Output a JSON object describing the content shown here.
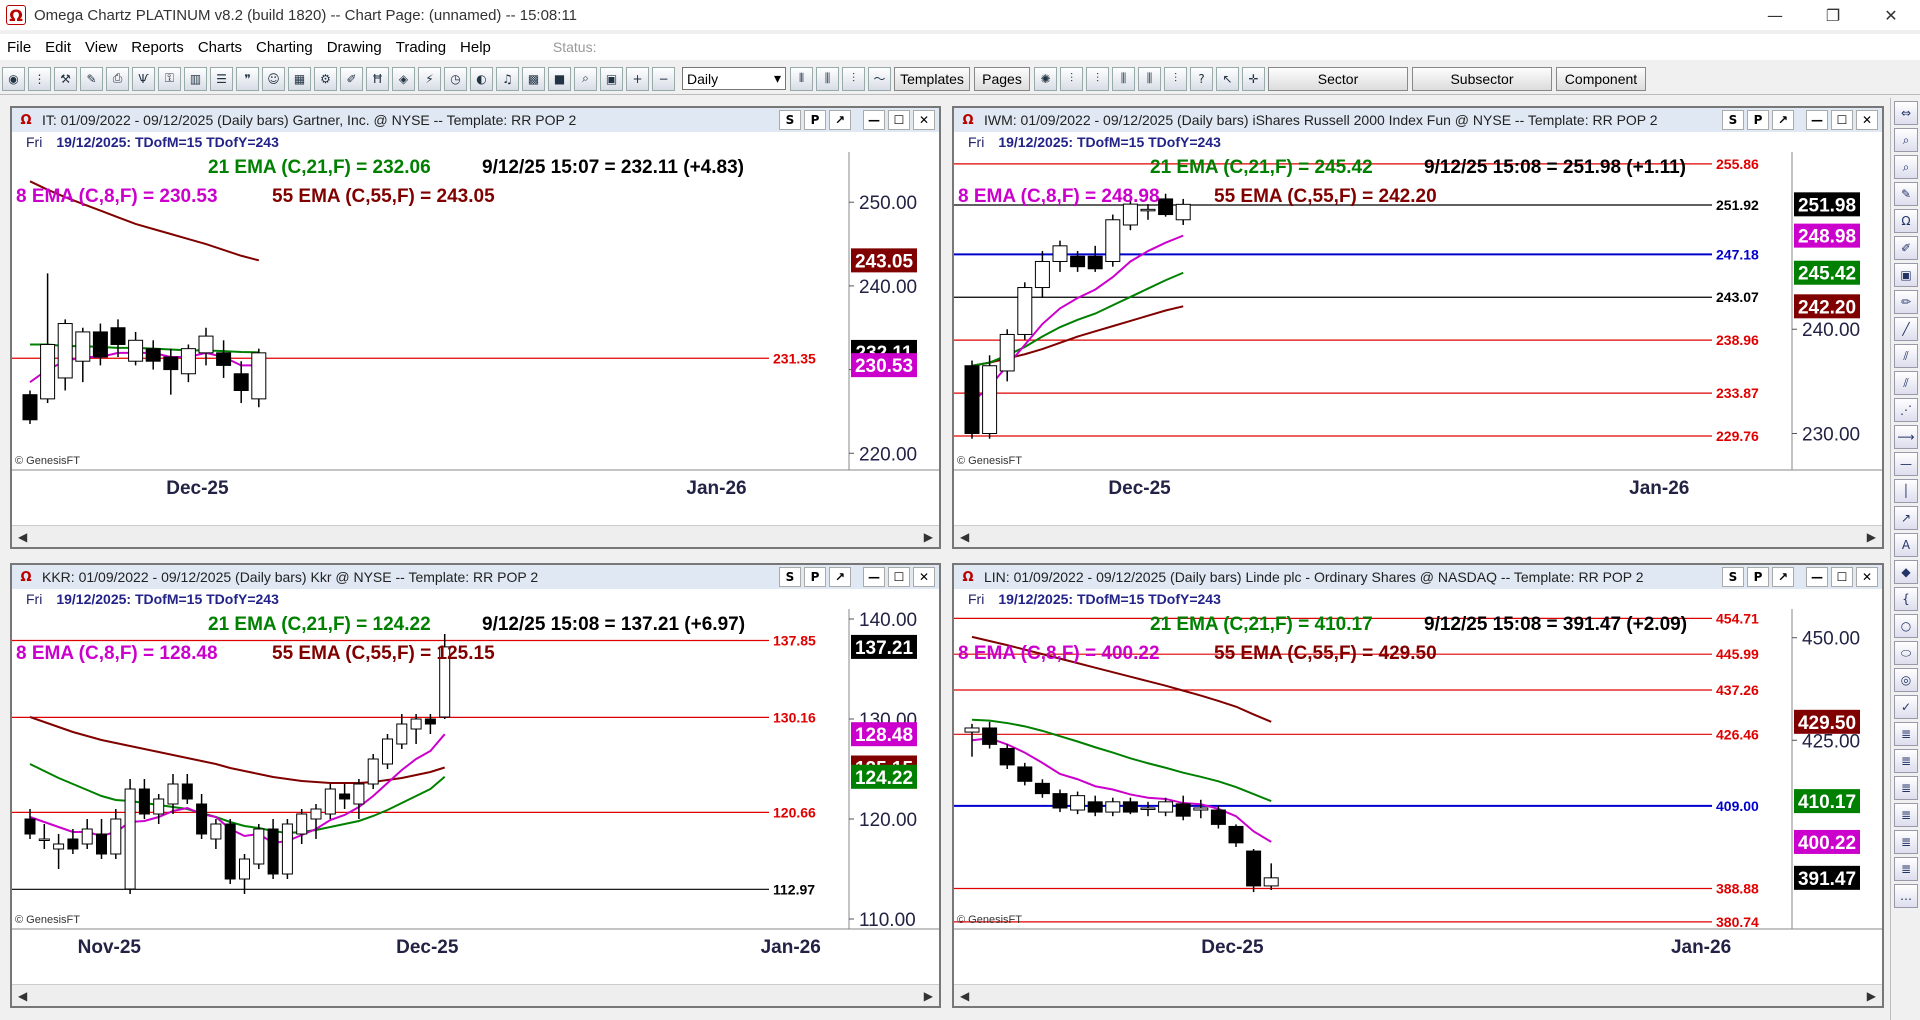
{
  "window": {
    "title": "Omega Chartz PLATINUM v8.2 (build 1820)  --  Chart Page: (unnamed) -- 15:08:11",
    "logo_glyph": "Ω",
    "controls": [
      "—",
      "❐",
      "✕"
    ]
  },
  "menu": {
    "items": [
      "File",
      "Edit",
      "View",
      "Reports",
      "Charts",
      "Charting",
      "Drawing",
      "Trading",
      "Help"
    ],
    "status_label": "Status:"
  },
  "toolbar": {
    "period_select": "Daily",
    "buttons": {
      "templates": "Templates",
      "pages": "Pages",
      "sector": "Sector",
      "subsector": "Subsector",
      "component": "Component"
    }
  },
  "colors": {
    "ema21": "#008000",
    "ema8": "#cc00cc",
    "ema55": "#800000",
    "hline_red": "#e00000",
    "hline_blue": "#0000cc",
    "header_bg": "#dfe8f3"
  },
  "panels": [
    {
      "key": "it",
      "header": "IT: 01/09/2022 - 09/12/2025  (Daily bars)   Gartner, Inc. @ NYSE  --  Template: RR POP 2",
      "sub": {
        "day": "Fri",
        "info": "19/12/2025:   TDofM=15   TDofY=243"
      },
      "ema21_text": "21 EMA (C,21,F) = 232.06",
      "quote_text": "9/12/25 15:07 = 232.11 (+4.83)",
      "ema8_text": "8 EMA (C,8,F) = 230.53",
      "ema55_text": "55 EMA (C,55,F) = 243.05",
      "copyright": "© GenesisFT",
      "x_labels": [
        {
          "text": "Dec-25",
          "pos": 0.2
        },
        {
          "text": "Jan-26",
          "pos": 0.76
        }
      ],
      "y_ticks": [
        220,
        230,
        240,
        250
      ],
      "y_tick_labels": [
        "220.00",
        "",
        "240.00",
        "250.00"
      ],
      "ylim": [
        218,
        256
      ],
      "hlines": [
        {
          "value": 231.35,
          "color": "red",
          "label": "231.35"
        }
      ],
      "badges": [
        {
          "value": 243.05,
          "text": "243.05",
          "bg": "#800000"
        },
        {
          "value": 232.11,
          "text": "232.11",
          "bg": "#000000"
        },
        {
          "value": 230.53,
          "text": "230.53",
          "bg": "#cc00cc"
        }
      ],
      "bars": [
        [
          227.0,
          227.5,
          223.5,
          224.0
        ],
        [
          226.5,
          241.5,
          226.0,
          233.0
        ],
        [
          229.0,
          236.0,
          227.5,
          235.5
        ],
        [
          231.0,
          235.0,
          228.5,
          234.5
        ],
        [
          234.5,
          235.5,
          230.5,
          231.5
        ],
        [
          235.0,
          236.0,
          231.5,
          233.0
        ],
        [
          231.0,
          234.5,
          230.5,
          233.5
        ],
        [
          232.5,
          233.5,
          230.0,
          231.0
        ],
        [
          231.5,
          232.5,
          227.0,
          230.0
        ],
        [
          229.5,
          233.0,
          228.5,
          232.5
        ],
        [
          232.0,
          235.0,
          230.5,
          234.0
        ],
        [
          232.0,
          233.5,
          229.0,
          230.5
        ],
        [
          229.5,
          231.0,
          226.0,
          227.5
        ],
        [
          226.5,
          232.5,
          225.5,
          232.0
        ]
      ],
      "ema8": [
        228.5,
        230.0,
        231.0,
        231.5,
        231.5,
        232.0,
        232.0,
        232.0,
        231.5,
        231.5,
        232.0,
        231.5,
        230.5,
        230.5
      ],
      "ema21": [
        233.0,
        233.0,
        232.8,
        232.8,
        232.7,
        232.6,
        232.6,
        232.5,
        232.4,
        232.3,
        232.3,
        232.2,
        232.1,
        232.06
      ],
      "ema55": [
        252.5,
        251.5,
        250.6,
        249.8,
        249.0,
        248.2,
        247.4,
        246.8,
        246.2,
        245.6,
        245.0,
        244.3,
        243.6,
        243.05
      ]
    },
    {
      "key": "iwm",
      "header": "IWM: 01/09/2022 - 09/12/2025  (Daily bars)   iShares Russell 2000 Index Fun @ NYSE  --  Template: RR POP 2",
      "sub": {
        "day": "Fri",
        "info": "19/12/2025:   TDofM=15   TDofY=243"
      },
      "ema21_text": "21 EMA (C,21,F) = 245.42",
      "quote_text": "9/12/25 15:08 = 251.98 (+1.11)",
      "ema8_text": "8 EMA (C,8,F) = 248.98",
      "ema55_text": "55 EMA (C,55,F) = 242.20",
      "copyright": "© GenesisFT",
      "x_labels": [
        {
          "text": "Dec-25",
          "pos": 0.2
        },
        {
          "text": "Jan-26",
          "pos": 0.76
        }
      ],
      "y_ticks": [
        230,
        240
      ],
      "y_tick_labels": [
        "230.00",
        "240.00"
      ],
      "ylim": [
        226.5,
        257
      ],
      "hlines": [
        {
          "value": 255.86,
          "color": "red",
          "label": "255.86"
        },
        {
          "value": 251.92,
          "color": "black",
          "label": "251.92"
        },
        {
          "value": 247.18,
          "color": "blue",
          "label": "247.18"
        },
        {
          "value": 243.07,
          "color": "black",
          "label": "243.07"
        },
        {
          "value": 238.96,
          "color": "red",
          "label": "238.96"
        },
        {
          "value": 233.87,
          "color": "red",
          "label": "233.87"
        },
        {
          "value": 229.76,
          "color": "red",
          "label": "229.76"
        }
      ],
      "badges": [
        {
          "value": 251.98,
          "text": "251.98",
          "bg": "#000000"
        },
        {
          "value": 248.98,
          "text": "248.98",
          "bg": "#cc00cc"
        },
        {
          "value": 245.42,
          "text": "245.42",
          "bg": "#008000"
        },
        {
          "value": 242.2,
          "text": "242.20",
          "bg": "#800000"
        }
      ],
      "bars": [
        [
          236.5,
          237.0,
          229.5,
          230.0
        ],
        [
          230.0,
          237.5,
          229.5,
          236.5
        ],
        [
          236.0,
          240.0,
          235.0,
          239.5
        ],
        [
          239.5,
          244.5,
          239.0,
          244.0
        ],
        [
          244.0,
          247.5,
          243.0,
          246.5
        ],
        [
          246.5,
          248.5,
          245.5,
          248.0
        ],
        [
          247.0,
          247.5,
          245.5,
          246.0
        ],
        [
          247.0,
          248.0,
          245.5,
          245.8
        ],
        [
          246.5,
          251.0,
          246.0,
          250.5
        ],
        [
          250.0,
          252.5,
          249.5,
          252.0
        ],
        [
          251.5,
          252.0,
          250.5,
          251.5
        ],
        [
          252.5,
          253.0,
          250.8,
          251.0
        ],
        [
          250.5,
          252.5,
          250.0,
          251.98
        ]
      ],
      "ema8": [
        233.0,
        234.5,
        236.5,
        238.5,
        240.5,
        242.0,
        243.0,
        243.8,
        245.0,
        246.5,
        247.5,
        248.3,
        248.98
      ],
      "ema21": [
        236.5,
        236.8,
        237.5,
        238.3,
        239.3,
        240.2,
        240.9,
        241.5,
        242.3,
        243.1,
        243.9,
        244.7,
        245.42
      ],
      "ema55": [
        236.5,
        236.8,
        237.2,
        237.6,
        238.1,
        238.7,
        239.3,
        239.8,
        240.3,
        240.8,
        241.3,
        241.8,
        242.2
      ]
    },
    {
      "key": "kkr",
      "header": "KKR: 01/09/2022 - 09/12/2025  (Daily bars)   Kkr @ NYSE  --  Template: RR POP 2",
      "sub": {
        "day": "Fri",
        "info": "19/12/2025:   TDofM=15   TDofY=243"
      },
      "ema21_text": "21 EMA (C,21,F) = 124.22",
      "quote_text": "9/12/25 15:08 = 137.21 (+6.97)",
      "ema8_text": "8 EMA (C,8,F) = 128.48",
      "ema55_text": "55 EMA (C,55,F) = 125.15",
      "copyright": "© GenesisFT",
      "x_labels": [
        {
          "text": "Nov-25",
          "pos": 0.105
        },
        {
          "text": "Dec-25",
          "pos": 0.448
        },
        {
          "text": "Jan-26",
          "pos": 0.84
        }
      ],
      "y_ticks": [
        110,
        120,
        130,
        140
      ],
      "y_tick_labels": [
        "110.00",
        "120.00",
        "130.00",
        "140.00"
      ],
      "ylim": [
        109,
        141
      ],
      "hlines": [
        {
          "value": 137.85,
          "color": "red",
          "label": "137.85"
        },
        {
          "value": 130.16,
          "color": "red",
          "label": "130.16"
        },
        {
          "value": 120.66,
          "color": "red",
          "label": "120.66"
        },
        {
          "value": 112.97,
          "color": "black",
          "label": "112.97"
        }
      ],
      "badges": [
        {
          "value": 137.21,
          "text": "137.21",
          "bg": "#000000"
        },
        {
          "value": 128.48,
          "text": "128.48",
          "bg": "#cc00cc"
        },
        {
          "value": 125.15,
          "text": "125.15",
          "bg": "#800000"
        },
        {
          "value": 124.22,
          "text": "124.22",
          "bg": "#008000"
        }
      ],
      "bars": [
        [
          120.0,
          121.0,
          118.0,
          118.5
        ],
        [
          118.0,
          119.5,
          117.0,
          118.0
        ],
        [
          117.0,
          118.5,
          115.0,
          117.5
        ],
        [
          118.0,
          119.0,
          116.5,
          117.0
        ],
        [
          117.5,
          120.0,
          117.0,
          119.0
        ],
        [
          118.5,
          120.0,
          116.0,
          116.5
        ],
        [
          116.5,
          121.0,
          116.0,
          120.0
        ],
        [
          113.0,
          124.0,
          112.5,
          123.0
        ],
        [
          123.0,
          124.0,
          120.0,
          120.5
        ],
        [
          120.5,
          122.5,
          119.5,
          122.0
        ],
        [
          121.5,
          124.5,
          120.5,
          123.5
        ],
        [
          123.5,
          124.5,
          121.5,
          122.0
        ],
        [
          121.5,
          122.5,
          118.0,
          118.5
        ],
        [
          118.0,
          120.0,
          117.0,
          119.5
        ],
        [
          119.5,
          120.0,
          113.5,
          114.0
        ],
        [
          114.0,
          116.5,
          112.5,
          116.0
        ],
        [
          115.5,
          119.5,
          115.0,
          119.0
        ],
        [
          119.0,
          120.0,
          114.0,
          114.5
        ],
        [
          114.5,
          120.0,
          114.0,
          119.5
        ],
        [
          118.5,
          121.0,
          117.5,
          120.5
        ],
        [
          120.0,
          121.5,
          118.0,
          121.0
        ],
        [
          120.5,
          123.5,
          120.0,
          123.0
        ],
        [
          122.5,
          123.5,
          121.0,
          122.0
        ],
        [
          121.5,
          124.0,
          120.0,
          123.5
        ],
        [
          123.5,
          126.5,
          123.0,
          126.0
        ],
        [
          125.5,
          128.5,
          125.0,
          128.0
        ],
        [
          127.5,
          130.5,
          127.0,
          129.5
        ],
        [
          129.0,
          130.5,
          127.5,
          130.0
        ],
        [
          130.0,
          130.5,
          128.5,
          129.5
        ],
        [
          130.2,
          138.5,
          130.0,
          137.21
        ]
      ],
      "ema8": [
        120.2,
        119.7,
        119.2,
        118.7,
        118.7,
        118.3,
        118.7,
        119.7,
        119.8,
        120.2,
        120.8,
        121.1,
        120.5,
        120.2,
        119.0,
        118.3,
        118.5,
        117.6,
        117.8,
        118.4,
        119.0,
        119.9,
        120.4,
        121.2,
        122.3,
        123.6,
        124.9,
        126.0,
        126.8,
        128.48
      ],
      "ema21": [
        125.5,
        124.8,
        124.1,
        123.5,
        122.9,
        122.3,
        121.9,
        121.8,
        121.6,
        121.4,
        121.2,
        121.0,
        120.6,
        120.2,
        119.7,
        119.3,
        119.1,
        118.8,
        118.6,
        118.7,
        118.9,
        119.2,
        119.5,
        119.8,
        120.3,
        120.9,
        121.6,
        122.3,
        123.0,
        124.22
      ],
      "ema55": [
        130.2,
        129.7,
        129.2,
        128.7,
        128.3,
        127.9,
        127.6,
        127.3,
        127.0,
        126.7,
        126.4,
        126.1,
        125.8,
        125.5,
        125.1,
        124.8,
        124.5,
        124.2,
        124.0,
        123.8,
        123.7,
        123.6,
        123.6,
        123.6,
        123.7,
        123.9,
        124.1,
        124.4,
        124.7,
        125.15
      ]
    },
    {
      "key": "lin",
      "header": "LIN: 01/09/2022 - 09/12/2025  (Daily bars)   Linde plc - Ordinary Shares @ NASDAQ  --  Template: RR POP 2",
      "sub": {
        "day": "Fri",
        "info": "19/12/2025:   TDofM=15   TDofY=243"
      },
      "ema21_text": "21 EMA (C,21,F) = 410.17",
      "quote_text": "9/12/25 15:08 = 391.47 (+2.09)",
      "ema8_text": "8 EMA (C,8,F) = 400.22",
      "ema55_text": "55 EMA (C,55,F) = 429.50",
      "copyright": "© GenesisFT",
      "x_labels": [
        {
          "text": "Dec-25",
          "pos": 0.3
        },
        {
          "text": "Jan-26",
          "pos": 0.805
        }
      ],
      "y_ticks": [
        425,
        450
      ],
      "y_tick_labels": [
        "425.00",
        "450.00"
      ],
      "ylim": [
        379,
        457
      ],
      "hlines": [
        {
          "value": 454.71,
          "color": "red",
          "label": "454.71"
        },
        {
          "value": 445.99,
          "color": "red",
          "label": "445.99"
        },
        {
          "value": 437.26,
          "color": "red",
          "label": "437.26"
        },
        {
          "value": 426.46,
          "color": "red",
          "label": "426.46"
        },
        {
          "value": 409.0,
          "color": "blue",
          "label": "409.00"
        },
        {
          "value": 388.88,
          "color": "red",
          "label": "388.88"
        },
        {
          "value": 380.74,
          "color": "red",
          "label": "380.74"
        }
      ],
      "badges": [
        {
          "value": 429.5,
          "text": "429.50",
          "bg": "#800000"
        },
        {
          "value": 410.17,
          "text": "410.17",
          "bg": "#008000"
        },
        {
          "value": 400.22,
          "text": "400.22",
          "bg": "#cc00cc"
        },
        {
          "value": 391.47,
          "text": "391.47",
          "bg": "#000000"
        }
      ],
      "bars": [
        [
          427.0,
          429.0,
          421.0,
          428.0
        ],
        [
          428.0,
          429.5,
          423.0,
          424.0
        ],
        [
          423.0,
          424.0,
          418.0,
          419.0
        ],
        [
          418.5,
          419.5,
          414.0,
          415.0
        ],
        [
          414.5,
          415.5,
          411.0,
          412.0
        ],
        [
          412.0,
          413.0,
          407.5,
          408.5
        ],
        [
          408.0,
          412.5,
          407.0,
          411.5
        ],
        [
          410.0,
          411.5,
          406.5,
          407.5
        ],
        [
          407.5,
          411.0,
          406.5,
          410.0
        ],
        [
          410.0,
          411.0,
          407.0,
          407.5
        ],
        [
          408.5,
          410.0,
          406.5,
          408.5
        ],
        [
          407.5,
          411.0,
          406.5,
          410.0
        ],
        [
          409.5,
          411.5,
          405.5,
          406.5
        ],
        [
          408.0,
          410.5,
          406.0,
          408.5
        ],
        [
          408.0,
          409.0,
          403.5,
          404.5
        ],
        [
          404.0,
          404.5,
          399.0,
          400.0
        ],
        [
          398.0,
          398.5,
          388.0,
          389.5
        ],
        [
          389.5,
          395.0,
          388.5,
          391.47
        ]
      ],
      "ema8": [
        425.0,
        425.5,
        424.0,
        422.0,
        419.5,
        416.8,
        415.5,
        413.8,
        413.0,
        411.8,
        411.0,
        410.7,
        409.7,
        409.4,
        408.3,
        406.5,
        402.8,
        400.22
      ],
      "ema21": [
        430.0,
        429.8,
        429.2,
        428.4,
        427.3,
        426.0,
        424.7,
        423.3,
        422.0,
        420.6,
        419.4,
        418.3,
        417.1,
        416.1,
        415.0,
        413.6,
        411.9,
        410.17
      ],
      "ema55": [
        450.2,
        449.2,
        448.2,
        447.1,
        446.0,
        444.9,
        443.8,
        442.7,
        441.6,
        440.5,
        439.4,
        438.3,
        437.1,
        435.9,
        434.6,
        433.2,
        431.3,
        429.5
      ]
    }
  ]
}
